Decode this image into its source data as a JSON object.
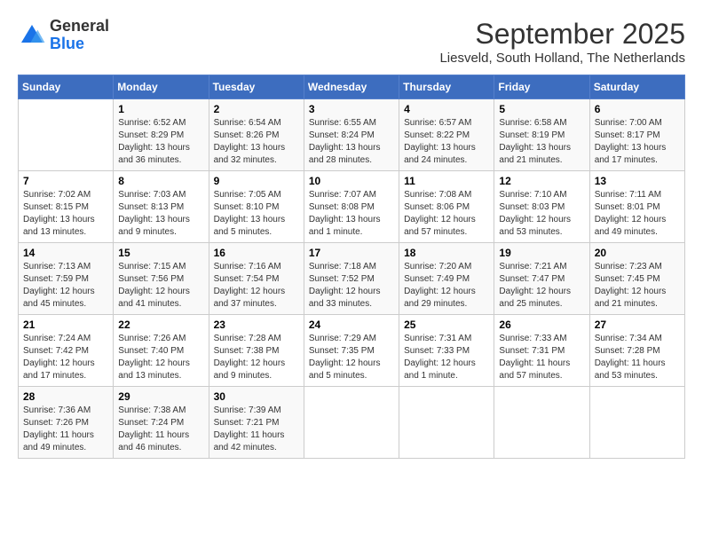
{
  "header": {
    "logo_line1": "General",
    "logo_line2": "Blue",
    "month_title": "September 2025",
    "location": "Liesveld, South Holland, The Netherlands"
  },
  "weekdays": [
    "Sunday",
    "Monday",
    "Tuesday",
    "Wednesday",
    "Thursday",
    "Friday",
    "Saturday"
  ],
  "weeks": [
    [
      {
        "day": "",
        "sunrise": "",
        "sunset": "",
        "daylight": ""
      },
      {
        "day": "1",
        "sunrise": "Sunrise: 6:52 AM",
        "sunset": "Sunset: 8:29 PM",
        "daylight": "Daylight: 13 hours and 36 minutes."
      },
      {
        "day": "2",
        "sunrise": "Sunrise: 6:54 AM",
        "sunset": "Sunset: 8:26 PM",
        "daylight": "Daylight: 13 hours and 32 minutes."
      },
      {
        "day": "3",
        "sunrise": "Sunrise: 6:55 AM",
        "sunset": "Sunset: 8:24 PM",
        "daylight": "Daylight: 13 hours and 28 minutes."
      },
      {
        "day": "4",
        "sunrise": "Sunrise: 6:57 AM",
        "sunset": "Sunset: 8:22 PM",
        "daylight": "Daylight: 13 hours and 24 minutes."
      },
      {
        "day": "5",
        "sunrise": "Sunrise: 6:58 AM",
        "sunset": "Sunset: 8:19 PM",
        "daylight": "Daylight: 13 hours and 21 minutes."
      },
      {
        "day": "6",
        "sunrise": "Sunrise: 7:00 AM",
        "sunset": "Sunset: 8:17 PM",
        "daylight": "Daylight: 13 hours and 17 minutes."
      }
    ],
    [
      {
        "day": "7",
        "sunrise": "Sunrise: 7:02 AM",
        "sunset": "Sunset: 8:15 PM",
        "daylight": "Daylight: 13 hours and 13 minutes."
      },
      {
        "day": "8",
        "sunrise": "Sunrise: 7:03 AM",
        "sunset": "Sunset: 8:13 PM",
        "daylight": "Daylight: 13 hours and 9 minutes."
      },
      {
        "day": "9",
        "sunrise": "Sunrise: 7:05 AM",
        "sunset": "Sunset: 8:10 PM",
        "daylight": "Daylight: 13 hours and 5 minutes."
      },
      {
        "day": "10",
        "sunrise": "Sunrise: 7:07 AM",
        "sunset": "Sunset: 8:08 PM",
        "daylight": "Daylight: 13 hours and 1 minute."
      },
      {
        "day": "11",
        "sunrise": "Sunrise: 7:08 AM",
        "sunset": "Sunset: 8:06 PM",
        "daylight": "Daylight: 12 hours and 57 minutes."
      },
      {
        "day": "12",
        "sunrise": "Sunrise: 7:10 AM",
        "sunset": "Sunset: 8:03 PM",
        "daylight": "Daylight: 12 hours and 53 minutes."
      },
      {
        "day": "13",
        "sunrise": "Sunrise: 7:11 AM",
        "sunset": "Sunset: 8:01 PM",
        "daylight": "Daylight: 12 hours and 49 minutes."
      }
    ],
    [
      {
        "day": "14",
        "sunrise": "Sunrise: 7:13 AM",
        "sunset": "Sunset: 7:59 PM",
        "daylight": "Daylight: 12 hours and 45 minutes."
      },
      {
        "day": "15",
        "sunrise": "Sunrise: 7:15 AM",
        "sunset": "Sunset: 7:56 PM",
        "daylight": "Daylight: 12 hours and 41 minutes."
      },
      {
        "day": "16",
        "sunrise": "Sunrise: 7:16 AM",
        "sunset": "Sunset: 7:54 PM",
        "daylight": "Daylight: 12 hours and 37 minutes."
      },
      {
        "day": "17",
        "sunrise": "Sunrise: 7:18 AM",
        "sunset": "Sunset: 7:52 PM",
        "daylight": "Daylight: 12 hours and 33 minutes."
      },
      {
        "day": "18",
        "sunrise": "Sunrise: 7:20 AM",
        "sunset": "Sunset: 7:49 PM",
        "daylight": "Daylight: 12 hours and 29 minutes."
      },
      {
        "day": "19",
        "sunrise": "Sunrise: 7:21 AM",
        "sunset": "Sunset: 7:47 PM",
        "daylight": "Daylight: 12 hours and 25 minutes."
      },
      {
        "day": "20",
        "sunrise": "Sunrise: 7:23 AM",
        "sunset": "Sunset: 7:45 PM",
        "daylight": "Daylight: 12 hours and 21 minutes."
      }
    ],
    [
      {
        "day": "21",
        "sunrise": "Sunrise: 7:24 AM",
        "sunset": "Sunset: 7:42 PM",
        "daylight": "Daylight: 12 hours and 17 minutes."
      },
      {
        "day": "22",
        "sunrise": "Sunrise: 7:26 AM",
        "sunset": "Sunset: 7:40 PM",
        "daylight": "Daylight: 12 hours and 13 minutes."
      },
      {
        "day": "23",
        "sunrise": "Sunrise: 7:28 AM",
        "sunset": "Sunset: 7:38 PM",
        "daylight": "Daylight: 12 hours and 9 minutes."
      },
      {
        "day": "24",
        "sunrise": "Sunrise: 7:29 AM",
        "sunset": "Sunset: 7:35 PM",
        "daylight": "Daylight: 12 hours and 5 minutes."
      },
      {
        "day": "25",
        "sunrise": "Sunrise: 7:31 AM",
        "sunset": "Sunset: 7:33 PM",
        "daylight": "Daylight: 12 hours and 1 minute."
      },
      {
        "day": "26",
        "sunrise": "Sunrise: 7:33 AM",
        "sunset": "Sunset: 7:31 PM",
        "daylight": "Daylight: 11 hours and 57 minutes."
      },
      {
        "day": "27",
        "sunrise": "Sunrise: 7:34 AM",
        "sunset": "Sunset: 7:28 PM",
        "daylight": "Daylight: 11 hours and 53 minutes."
      }
    ],
    [
      {
        "day": "28",
        "sunrise": "Sunrise: 7:36 AM",
        "sunset": "Sunset: 7:26 PM",
        "daylight": "Daylight: 11 hours and 49 minutes."
      },
      {
        "day": "29",
        "sunrise": "Sunrise: 7:38 AM",
        "sunset": "Sunset: 7:24 PM",
        "daylight": "Daylight: 11 hours and 46 minutes."
      },
      {
        "day": "30",
        "sunrise": "Sunrise: 7:39 AM",
        "sunset": "Sunset: 7:21 PM",
        "daylight": "Daylight: 11 hours and 42 minutes."
      },
      {
        "day": "",
        "sunrise": "",
        "sunset": "",
        "daylight": ""
      },
      {
        "day": "",
        "sunrise": "",
        "sunset": "",
        "daylight": ""
      },
      {
        "day": "",
        "sunrise": "",
        "sunset": "",
        "daylight": ""
      },
      {
        "day": "",
        "sunrise": "",
        "sunset": "",
        "daylight": ""
      }
    ]
  ]
}
